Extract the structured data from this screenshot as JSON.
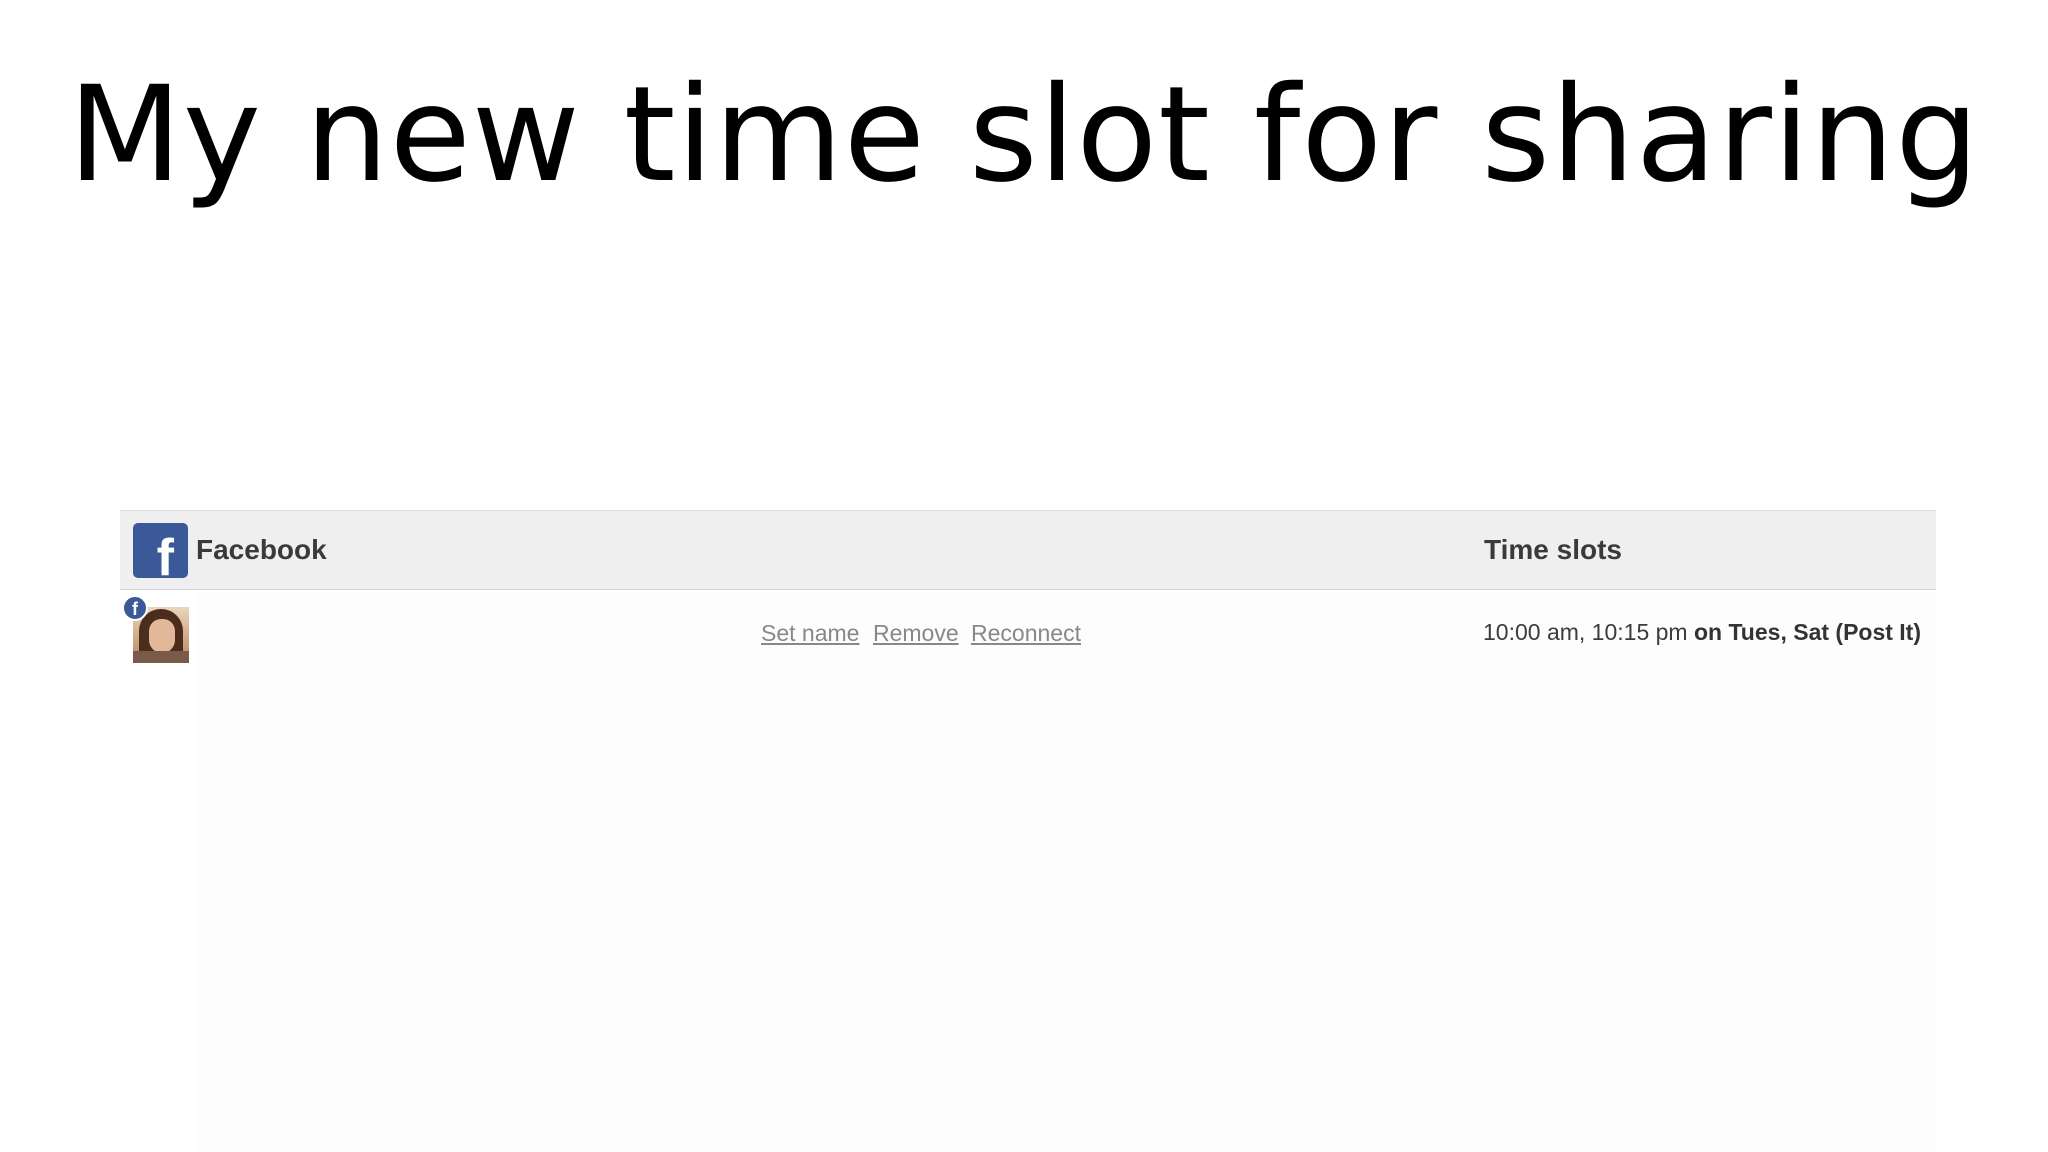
{
  "slide": {
    "title": "My new time slot for sharing"
  },
  "panel": {
    "header": {
      "network_label": "Facebook",
      "network_icon": "facebook-logo-icon",
      "timeslots_label": "Time slots"
    },
    "accounts": [
      {
        "avatar": "profile-photo",
        "badge_icon": "facebook-badge-icon",
        "actions": {
          "set_name": "Set name",
          "remove": "Remove",
          "reconnect": "Reconnect"
        },
        "times": "10:00 am, 10:15 pm",
        "on_word": "on",
        "days": "Tues, Sat",
        "mode": "(Post It)"
      }
    ]
  },
  "colors": {
    "facebook_blue": "#3b5998",
    "header_bg": "#f0efef",
    "link_gray": "#888888"
  }
}
